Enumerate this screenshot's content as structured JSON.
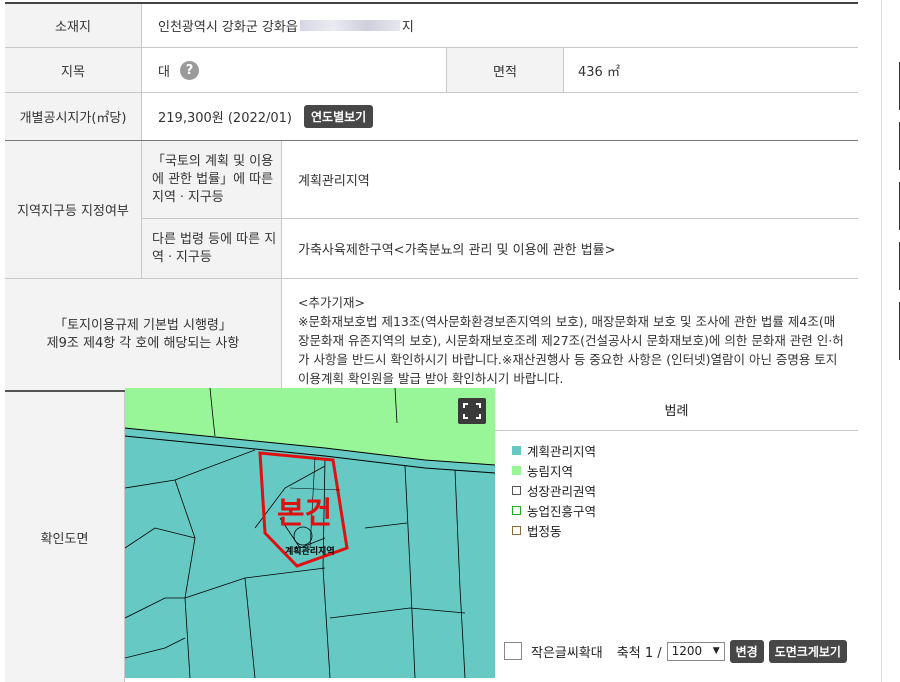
{
  "rows": {
    "location": {
      "label": "소재지",
      "value_prefix": "인천광역시 강화군 강화읍",
      "value_suffix": "지"
    },
    "land_category": {
      "label": "지목",
      "value": "대",
      "help": "?"
    },
    "area": {
      "label": "면적",
      "value": "436 ㎡"
    },
    "price": {
      "label": "개별공시지가(㎡당)",
      "value": "219,300원 (2022/01)",
      "button": "연도별보기"
    },
    "zoning": {
      "label": "지역지구등 지정여부",
      "sub1_label": "「국토의 계획 및 이용 에 관한 법률」에 따른 지역ㆍ지구등",
      "sub1_value": "계획관리지역",
      "sub2_label": "다른 법령 등에 따른 지역ㆍ지구등",
      "sub2_value": "가축사육제한구역<가축분뇨의 관리 및 이용에 관한 법률>"
    },
    "regulation": {
      "label1": "「토지이용규제 기본법 시행령」",
      "label2": "제9조 제4항 각 호에 해당되는 사항",
      "value_head": "<추가기재>",
      "value_body": "※문화재보호법 제13조(역사문화환경보존지역의 보호), 매장문화재 보호 및 조사에 관한 법률 제4조(매장문화재 유존지역의 보호), 시문화재보호조례 제27조(건설공사시 문화재보호)에 의한 문화재 관련 인·허가 사항을 반드시 확인하시기 바랍니다.※재산권행사 등 중요한 사항은 (인터넷)열람이 아닌 증명용 토지이용계획 확인원을 발급 받아 확인하시기 바랍니다."
    },
    "map_row": {
      "label": "확인도면"
    }
  },
  "map": {
    "overlay_text": "본건",
    "parcel_label": "계획관리지역",
    "colors": {
      "plan": "#66c9c3",
      "agri": "#98f598",
      "marker": "#e01010"
    }
  },
  "legend": {
    "title": "범례",
    "items": [
      {
        "label": "계획관리지역",
        "color": "#66c9c3",
        "filled": true
      },
      {
        "label": "농림지역",
        "color": "#98f598",
        "filled": true
      },
      {
        "label": "성장관리권역",
        "color": "#555555",
        "filled": false
      },
      {
        "label": "농업진흥구역",
        "color": "#22aa22",
        "filled": false
      },
      {
        "label": "법정동",
        "color": "#8a6a3a",
        "filled": false
      }
    ]
  },
  "controls": {
    "enlarge_label": "작은글씨확대",
    "scale_label": "축척 1 /",
    "scale_value": "1200",
    "change_button": "변경",
    "large_view_button": "도면크게보기"
  }
}
